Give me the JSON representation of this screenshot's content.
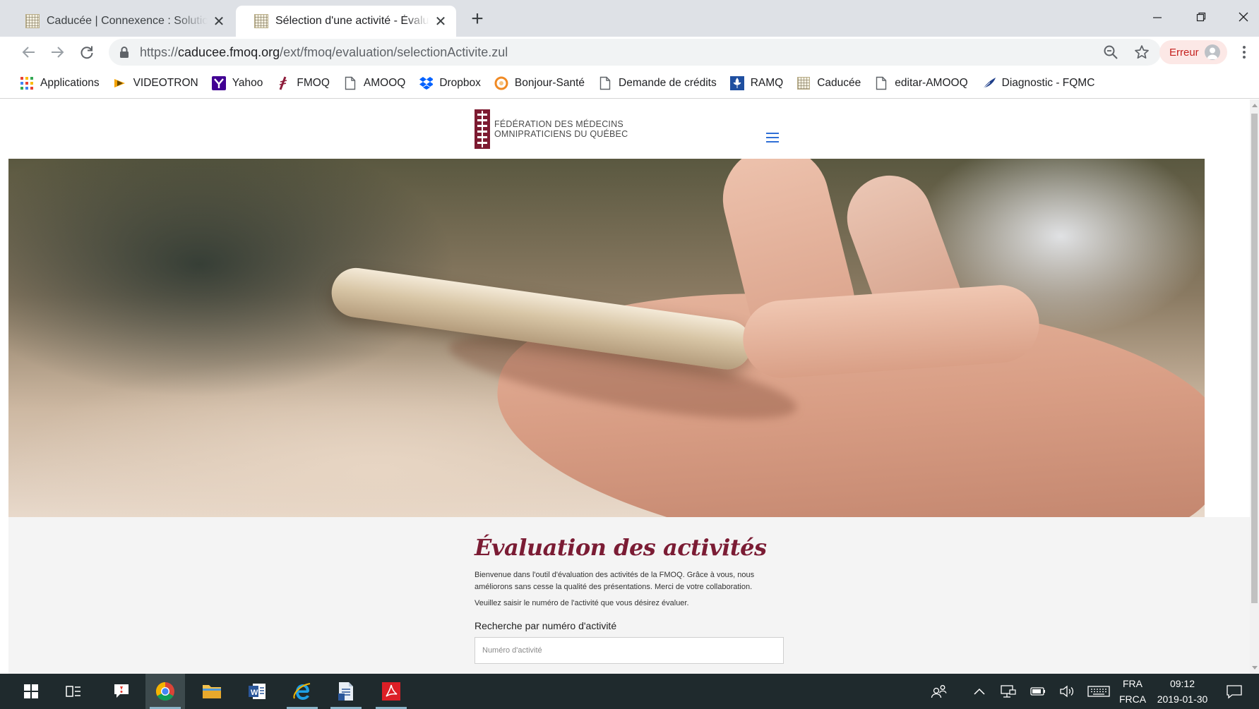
{
  "browser": {
    "tabs": [
      {
        "title": "Caducée | Connexence : Solution",
        "active": false
      },
      {
        "title": "Sélection d'une activité - Évaluation",
        "active": true
      }
    ],
    "address": {
      "scheme": "https://",
      "host": "caducee.fmoq.org",
      "path": "/ext/fmoq/evaluation/selectionActivite.zul"
    },
    "profile_status": "Erreur",
    "bookmarks": [
      {
        "label": "Applications",
        "icon": "apps-grid-icon"
      },
      {
        "label": "VIDEOTRON",
        "icon": "videotron-icon"
      },
      {
        "label": "Yahoo",
        "icon": "yahoo-icon"
      },
      {
        "label": "FMOQ",
        "icon": "fmoq-icon"
      },
      {
        "label": "AMOOQ",
        "icon": "page-icon"
      },
      {
        "label": "Dropbox",
        "icon": "dropbox-icon"
      },
      {
        "label": "Bonjour-Santé",
        "icon": "bonjour-sante-icon"
      },
      {
        "label": "Demande de crédits",
        "icon": "page-icon"
      },
      {
        "label": "RAMQ",
        "icon": "ramq-icon"
      },
      {
        "label": "Caducée",
        "icon": "caducee-icon"
      },
      {
        "label": "editar-AMOOQ",
        "icon": "page-icon"
      },
      {
        "label": "Diagnostic - FQMC",
        "icon": "feather-icon"
      }
    ]
  },
  "site": {
    "logo_line1": "FÉDÉRATION DES MÉDECINS",
    "logo_line2": "OMNIPRATICIENS DU QUÉBEC",
    "page_title": "Évaluation des activités",
    "intro_line1": "Bienvenue dans l'outil d'évaluation des activités de la FMOQ. Grâce à vous, nous",
    "intro_line2": "améliorons sans cesse la qualité des présentations. Merci de votre collaboration.",
    "instruction": "Veuillez saisir le numéro de l'activité que vous désirez évaluer.",
    "search_label": "Recherche par numéro d'activité",
    "search_placeholder": "Numéro d'activité",
    "search_value": ""
  },
  "taskbar": {
    "language_top": "FRA",
    "language_bottom": "FRCA",
    "time": "09:12",
    "date": "2019-01-30"
  },
  "colors": {
    "brand": "#7b1c34",
    "accent": "#2f6fd6",
    "taskbar": "#1f2a2d"
  }
}
